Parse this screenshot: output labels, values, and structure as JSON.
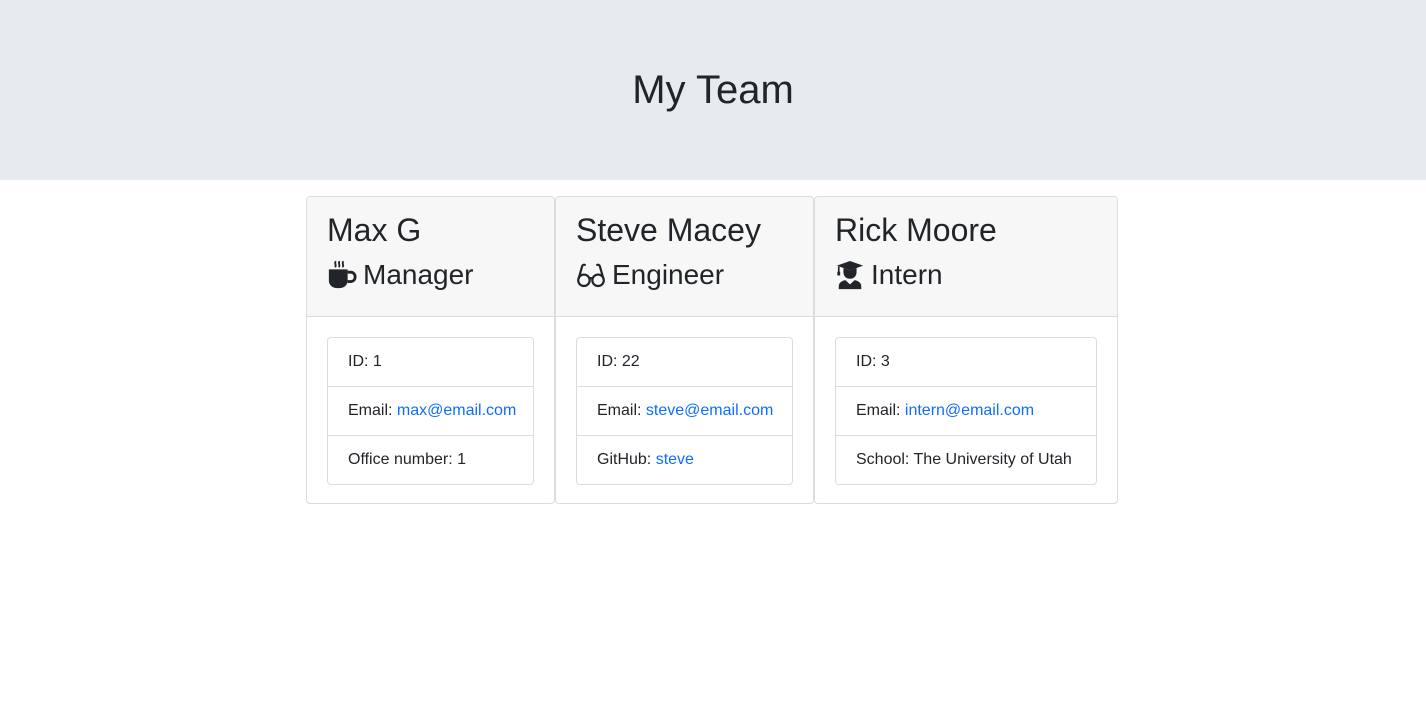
{
  "header": {
    "title": "My Team"
  },
  "team": [
    {
      "name": "Max G",
      "role": "Manager",
      "icon": "coffee-icon",
      "id_label": "ID:",
      "id": "1",
      "email_label": "Email:",
      "email": "max@email.com",
      "extra_label": "Office number:",
      "extra_value": "1"
    },
    {
      "name": "Steve Macey",
      "role": "Engineer",
      "icon": "glasses-icon",
      "id_label": "ID:",
      "id": "22",
      "email_label": "Email:",
      "email": "steve@email.com",
      "extra_label": "GitHub:",
      "extra_value": "steve"
    },
    {
      "name": "Rick Moore",
      "role": "Intern",
      "icon": "graduate-icon",
      "id_label": "ID:",
      "id": "3",
      "email_label": "Email:",
      "email": "intern@email.com",
      "extra_label": "School:",
      "extra_value": "The University of Utah"
    }
  ],
  "colors": {
    "header_bg": "#e7eaee",
    "card_header_bg": "#f7f7f7",
    "link": "#0d6efd",
    "text": "#212529"
  }
}
